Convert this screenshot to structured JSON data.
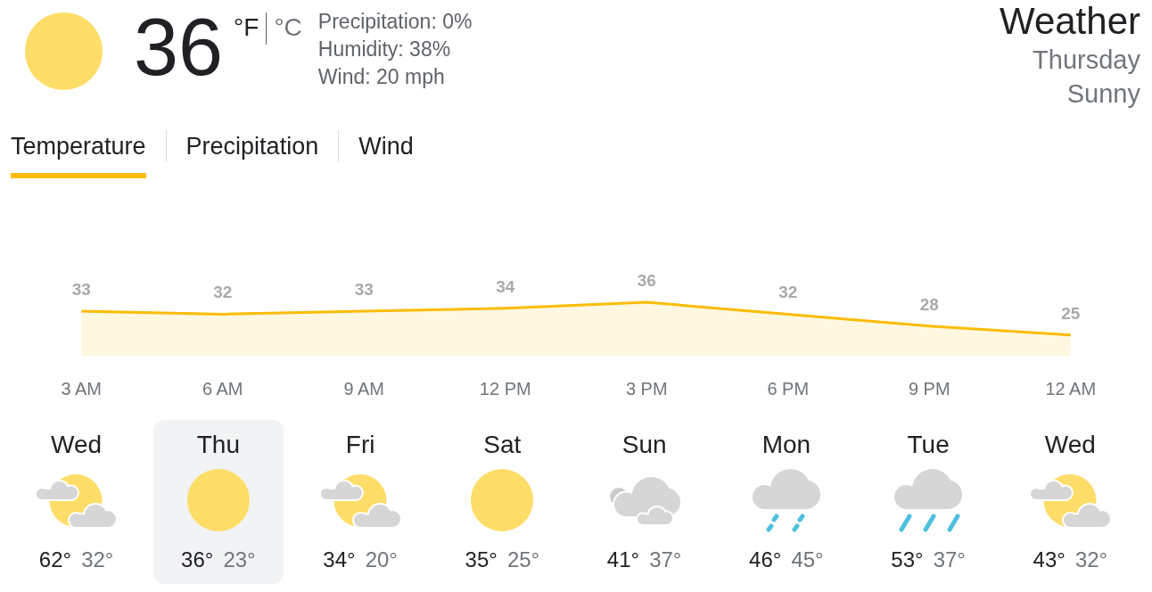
{
  "current": {
    "kind": "sunny",
    "temperature": "36",
    "units": [
      {
        "label": "°F",
        "selected": true
      },
      {
        "label": "°C",
        "selected": false
      }
    ],
    "details": [
      "Precipitation: 0%",
      "Humidity: 38%",
      "Wind: 20 mph"
    ]
  },
  "header": {
    "title": "Weather",
    "day": "Thursday",
    "condition": "Sunny"
  },
  "tabs": [
    {
      "label": "Temperature",
      "selected": true
    },
    {
      "label": "Precipitation",
      "selected": false
    },
    {
      "label": "Wind",
      "selected": false
    }
  ],
  "chart": {
    "chart_data": {
      "type": "area",
      "categories": [
        "3 AM",
        "6 AM",
        "9 AM",
        "12 PM",
        "3 PM",
        "6 PM",
        "9 PM",
        "12 AM"
      ],
      "series": [
        {
          "color": "#fbbc04",
          "values": [
            33,
            32,
            33,
            34,
            36,
            32,
            28,
            25
          ]
        }
      ],
      "data_labels": true
    }
  },
  "days": [
    {
      "day": "Wed",
      "kind": "partly_cloudy",
      "high": "62°",
      "low": "32°",
      "selected": false
    },
    {
      "day": "Thu",
      "kind": "sunny",
      "high": "36°",
      "low": "23°",
      "selected": true
    },
    {
      "day": "Fri",
      "kind": "partly_cloudy",
      "high": "34°",
      "low": "20°",
      "selected": false
    },
    {
      "day": "Sat",
      "kind": "sunny",
      "high": "35°",
      "low": "25°",
      "selected": false
    },
    {
      "day": "Sun",
      "kind": "cloudy",
      "high": "41°",
      "low": "37°",
      "selected": false
    },
    {
      "day": "Mon",
      "kind": "light_rain",
      "high": "46°",
      "low": "45°",
      "selected": false
    },
    {
      "day": "Tue",
      "kind": "rain",
      "high": "53°",
      "low": "37°",
      "selected": false
    },
    {
      "day": "Wed",
      "kind": "partly_cloudy",
      "high": "43°",
      "low": "32°",
      "selected": false
    }
  ]
}
